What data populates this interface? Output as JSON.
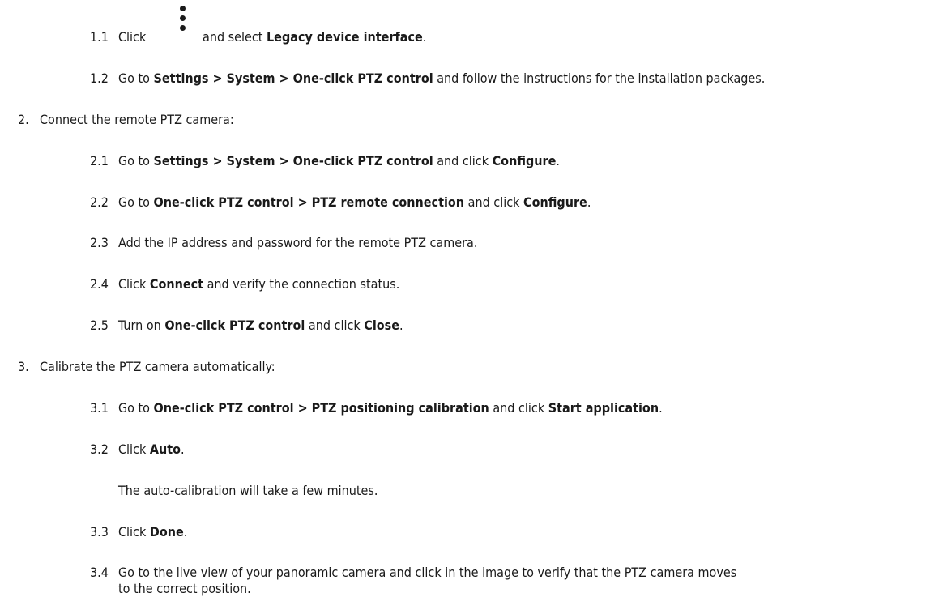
{
  "steps": [
    {
      "id": "1.1",
      "before": "Click",
      "icon": "more-vertical-icon",
      "after": " and select ",
      "bold1": "Legacy device interface",
      "end": "."
    },
    {
      "id": "1.2",
      "parts": [
        "Go to ",
        "Settings > System > One-click PTZ control",
        " and follow the instructions for the installation packages."
      ]
    },
    {
      "id": "2.",
      "parts": [
        "Connect the remote PTZ camera:"
      ]
    },
    {
      "id": "2.1",
      "parts": [
        "Go to ",
        "Settings > System > One-click PTZ control",
        " and click ",
        "Configure",
        "."
      ]
    },
    {
      "id": "2.2",
      "parts": [
        "Go to ",
        "One-click PTZ control > PTZ remote connection",
        " and click ",
        "Configure",
        "."
      ]
    },
    {
      "id": "2.3",
      "parts": [
        "Add the IP address and password for the remote PTZ camera."
      ]
    },
    {
      "id": "2.4",
      "parts": [
        "Click ",
        "Connect",
        " and verify the connection status."
      ]
    },
    {
      "id": "2.5",
      "parts": [
        "Turn on ",
        "One-click PTZ control",
        " and click ",
        "Close",
        "."
      ]
    },
    {
      "id": "3.",
      "parts": [
        "Calibrate the PTZ camera automatically:"
      ]
    },
    {
      "id": "3.1",
      "parts": [
        "Go to ",
        "One-click PTZ control > PTZ positioning calibration",
        " and click ",
        "Start application",
        "."
      ]
    },
    {
      "id": "3.2",
      "parts": [
        "Click ",
        "Auto",
        "."
      ]
    },
    {
      "id": "3.2-note",
      "parts": [
        "The auto-calibration will take a few minutes."
      ]
    },
    {
      "id": "3.3",
      "parts": [
        "Click ",
        "Done",
        "."
      ]
    },
    {
      "id": "3.4",
      "parts": [
        "Go to the live view of your panoramic camera and click in the image to verify that the PTZ camera moves",
        "to the correct position."
      ]
    }
  ]
}
